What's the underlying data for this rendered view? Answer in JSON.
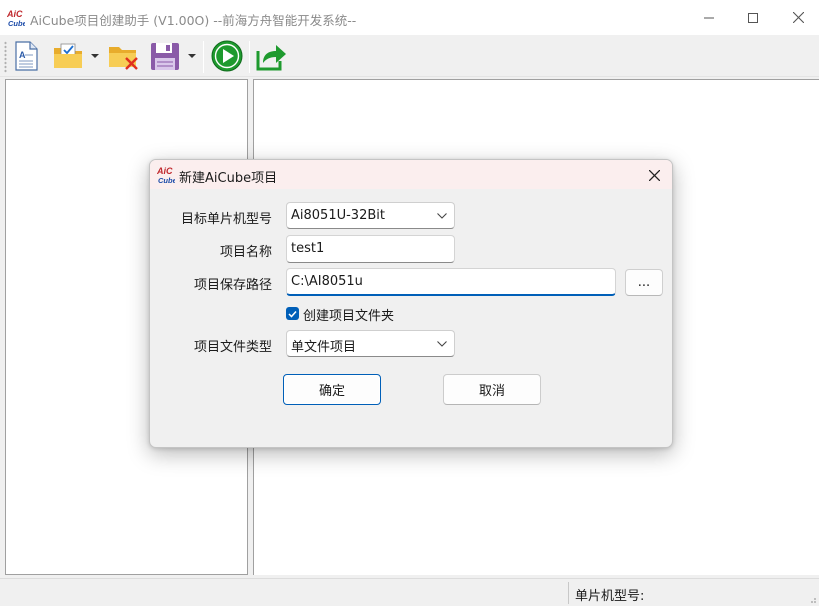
{
  "window": {
    "title": "AiCube项目创建助手 (V1.00O) --前海方舟智能开发系统--",
    "logo_text_top": "AiC",
    "logo_text_bottom": "Cube"
  },
  "toolbar": {
    "buttons": [
      {
        "icon": "new-file-icon"
      },
      {
        "icon": "open-folder-icon",
        "has_dropdown": true
      },
      {
        "icon": "close-folder-icon"
      },
      {
        "icon": "save-disk-icon",
        "has_dropdown": true
      },
      {
        "icon": "run-play-icon"
      },
      {
        "icon": "export-share-icon"
      }
    ]
  },
  "statusbar": {
    "mcu_label": "单片机型号:"
  },
  "dialog": {
    "title": "新建AiCube项目",
    "fields": {
      "mcu_model": {
        "label": "目标单片机型号",
        "value": "Ai8051U-32Bit"
      },
      "project_name": {
        "label": "项目名称",
        "value": "test1"
      },
      "save_path": {
        "label": "项目保存路径",
        "value": "C:\\AI8051u",
        "browse_label": "..."
      },
      "create_folder": {
        "label": "创建项目文件夹",
        "checked": true
      },
      "file_type": {
        "label": "项目文件类型",
        "value": "单文件项目"
      }
    },
    "ok_label": "确定",
    "cancel_label": "取消"
  },
  "colors": {
    "accent": "#005fb8",
    "dialog_titlebar": "#fbeeee",
    "run_green": "#1e9a2e",
    "folder_yellow": "#f5c342",
    "save_purple": "#8a5aa8"
  }
}
